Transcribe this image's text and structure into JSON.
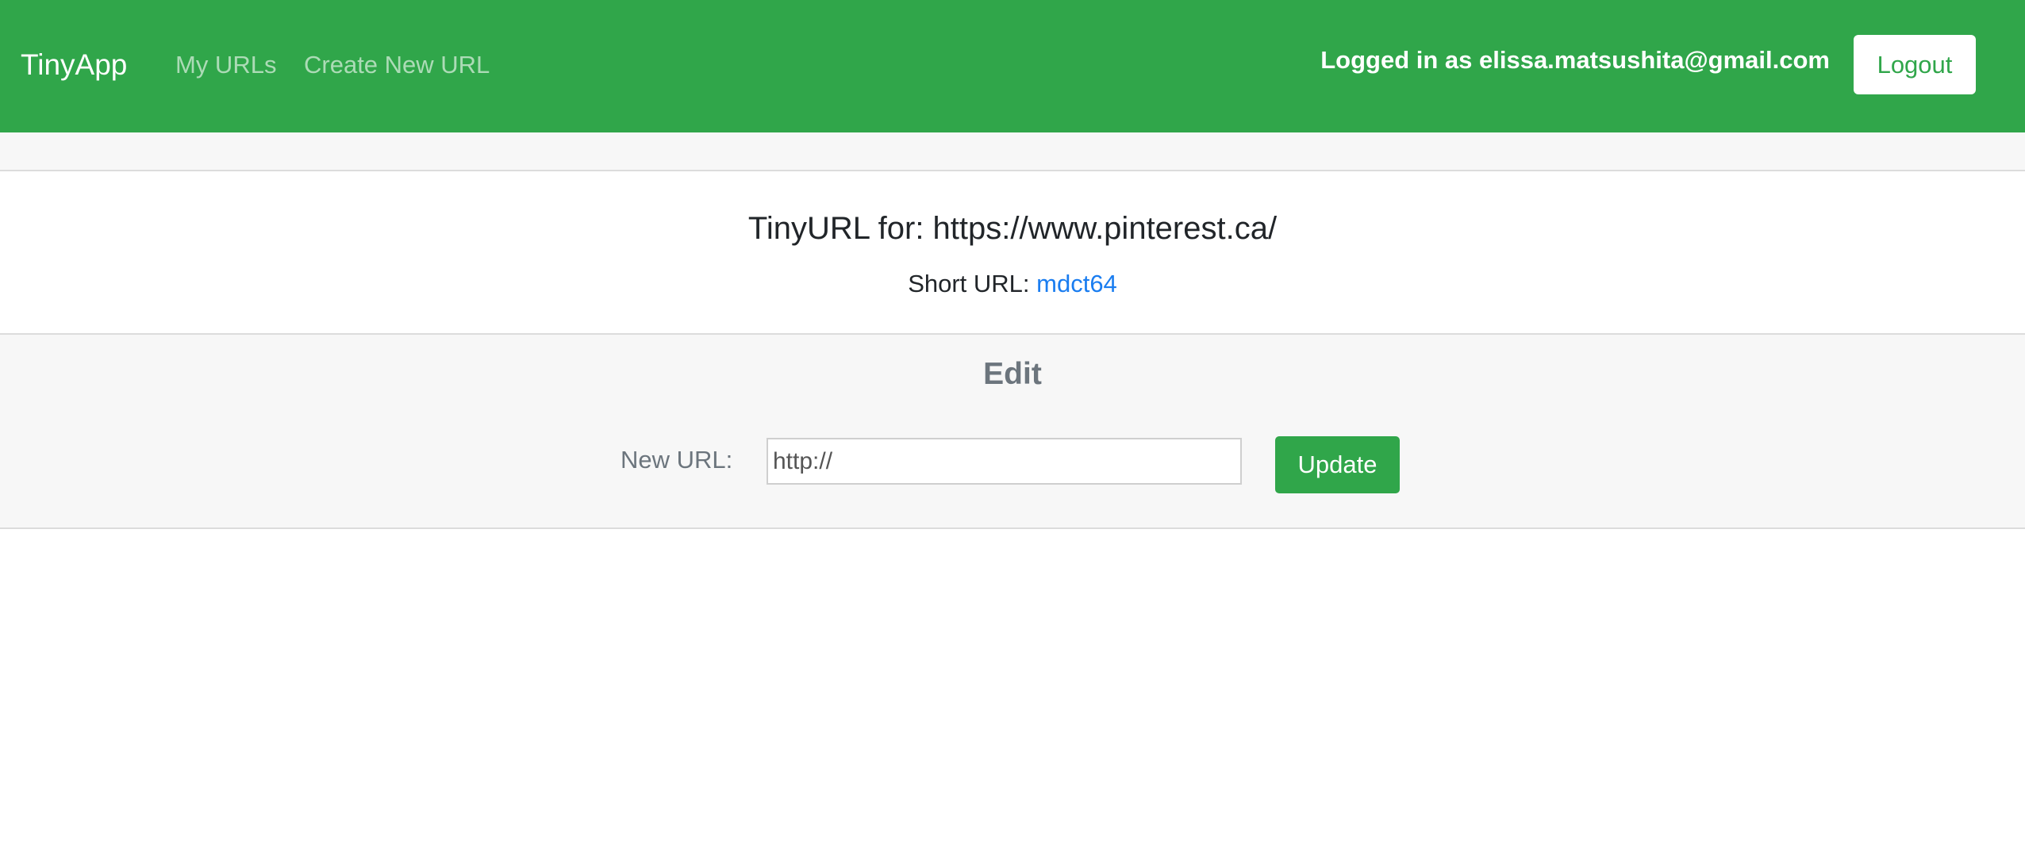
{
  "navbar": {
    "brand": "TinyApp",
    "links": [
      {
        "label": "My URLs"
      },
      {
        "label": "Create New URL"
      }
    ],
    "logged_in_text": "Logged in as elissa.matsushita@gmail.com",
    "logout_label": "Logout",
    "colors": {
      "background": "#30a64a",
      "text": "#ffffff",
      "muted_link": "rgba(255,255,255,0.6)"
    }
  },
  "card": {
    "title": "TinyURL for: https://www.pinterest.ca/",
    "short_url_label": "Short URL: ",
    "short_url_value": "mdct64",
    "link_color": "#1a7df0"
  },
  "edit": {
    "heading": "Edit",
    "new_url_label": "New URL:",
    "input_placeholder": "http://",
    "update_label": "Update",
    "button_color": "#30a64a"
  }
}
